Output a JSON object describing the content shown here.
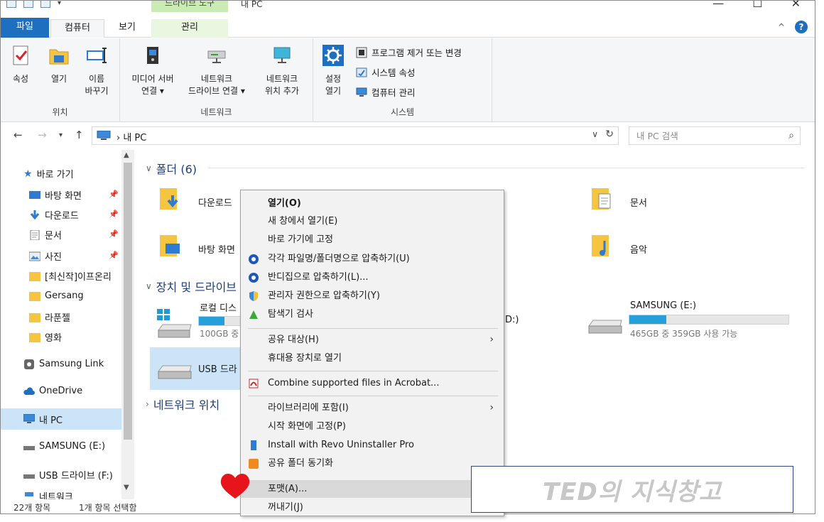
{
  "window": {
    "contextual_tab_group": "드라이브 도구",
    "title": "내 PC"
  },
  "ribbon_tabs": {
    "file": "파일",
    "computer": "컴퓨터",
    "view": "보기",
    "manage": "관리"
  },
  "ribbon": {
    "location_group": "위치",
    "network_group": "네트워크",
    "system_group": "시스템",
    "properties": "속성",
    "open": "열기",
    "rename_line1": "이름",
    "rename_line2": "바꾸기",
    "media_server_line1": "미디어 서버",
    "media_server_line2": "연결 ▾",
    "map_drive_line1": "네트워크",
    "map_drive_line2": "드라이브 연결 ▾",
    "add_location_line1": "네트워크",
    "add_location_line2": "위치 추가",
    "settings_line1": "설정",
    "settings_line2": "열기",
    "uninstall": "프로그램 제거 또는 변경",
    "system_props": "시스템 속성",
    "manage_computer": "컴퓨터 관리"
  },
  "address": {
    "crumb": "내 PC",
    "search_placeholder": "내 PC 검색"
  },
  "nav": {
    "quick_access": "바로 가기",
    "desktop": "바탕 화면",
    "downloads": "다운로드",
    "documents": "문서",
    "pictures": "사진",
    "f1": "[최신작]이프온리",
    "f2": "Gersang",
    "f3": "라푼젤",
    "f4": "영화",
    "samsung_link": "Samsung Link",
    "onedrive": "OneDrive",
    "this_pc": "내 PC",
    "samsung_e": "SAMSUNG (E:)",
    "usb_f": "USB 드라이브 (F:)",
    "network_partial": "네트워크"
  },
  "content": {
    "folders_header": "폴더 (6)",
    "devices_header": "장치 및 드라이브",
    "network_header": "네트워크 위치",
    "downloads": "다운로드",
    "desktop": "바탕 화면",
    "documents": "문서",
    "music": "음악",
    "local_disk": "로컬 디스",
    "local_disk_info": "100GB 중",
    "dvd_partial": "D:)",
    "usb": "USB 드라",
    "samsung_name": "SAMSUNG (E:)",
    "samsung_info": "465GB 중 359GB 사용 가능",
    "samsung_used_fraction": 0.23,
    "local_used_fraction": 0.62
  },
  "status": {
    "count": "22개 항목",
    "selected": "1개 항목 선택함"
  },
  "context_menu": {
    "open": "열기(O)",
    "open_new_window": "새 창에서 열기(E)",
    "pin_quick": "바로 가기에 고정",
    "compress_each": "각각 파일명/폴더명으로 압축하기(U)",
    "compress_bandizip": "반디집으로 압축하기(L)...",
    "compress_admin": "관리자 권한으로 압축하기(Y)",
    "explorer_scan": "탐색기 검사",
    "share_with": "공유 대상(H)",
    "open_portable": "휴대용 장치로 열기",
    "acrobat": "Combine supported files in Acrobat...",
    "include_library": "라이브러리에 포함(I)",
    "pin_start": "시작 화면에 고정(P)",
    "revo": "Install with Revo Uninstaller Pro",
    "shared_sync": "공유 폴더 동기화",
    "format": "포맷(A)...",
    "eject": "꺼내기(J)"
  },
  "watermark": "TED의 지식창고",
  "colors": {
    "accent": "#1f6fc0",
    "selection": "#cce4f7",
    "drive_bar": "#26a0da",
    "contextual_tab": "#c9ebb4",
    "heart": "#e8141b"
  }
}
